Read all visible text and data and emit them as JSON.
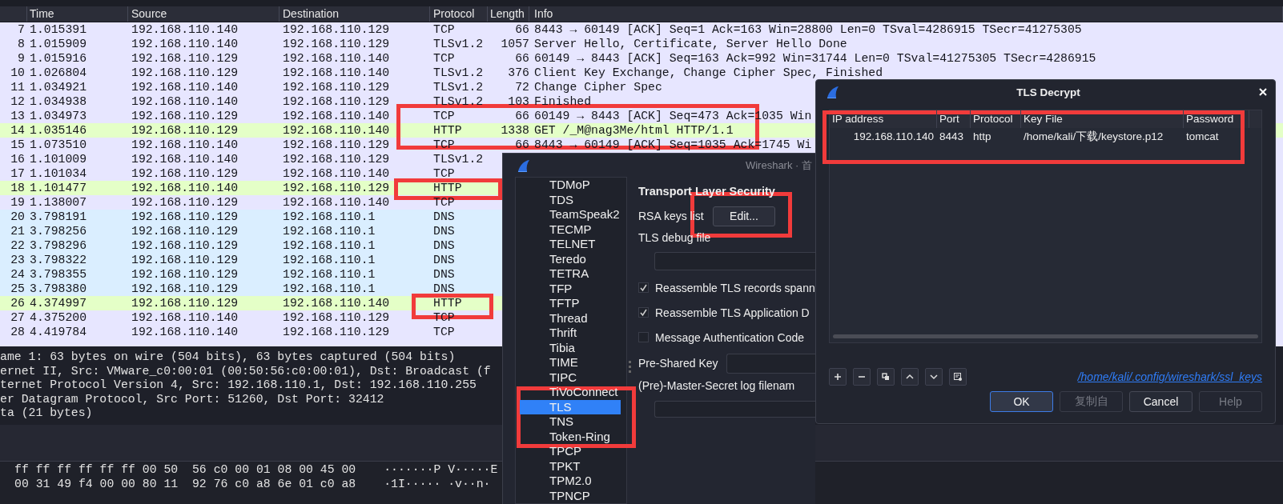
{
  "packet_list": {
    "columns": [
      "Time",
      "Source",
      "Destination",
      "Protocol",
      "Length",
      "Info"
    ],
    "rows": [
      {
        "no": "7",
        "time": "1.015391",
        "source": "192.168.110.140",
        "destination": "192.168.110.129",
        "protocol": "TCP",
        "length": "66",
        "info": "8443 → 60149 [ACK] Seq=1 Ack=163 Win=28800 Len=0 TSval=4286915 TSecr=41275305",
        "color": "#e7e6ff"
      },
      {
        "no": "8",
        "time": "1.015909",
        "source": "192.168.110.140",
        "destination": "192.168.110.129",
        "protocol": "TLSv1.2",
        "length": "1057",
        "info": "Server Hello, Certificate, Server Hello Done",
        "color": "#e7e6ff"
      },
      {
        "no": "9",
        "time": "1.015916",
        "source": "192.168.110.129",
        "destination": "192.168.110.140",
        "protocol": "TCP",
        "length": "66",
        "info": "60149 → 8443 [ACK] Seq=163 Ack=992 Win=31744 Len=0 TSval=41275305 TSecr=4286915",
        "color": "#e7e6ff"
      },
      {
        "no": "10",
        "time": "1.026804",
        "source": "192.168.110.129",
        "destination": "192.168.110.140",
        "protocol": "TLSv1.2",
        "length": "376",
        "info": "Client Key Exchange, Change Cipher Spec, Finished",
        "color": "#e7e6ff"
      },
      {
        "no": "11",
        "time": "1.034921",
        "source": "192.168.110.140",
        "destination": "192.168.110.129",
        "protocol": "TLSv1.2",
        "length": "72",
        "info": "Change Cipher Spec",
        "color": "#e7e6ff"
      },
      {
        "no": "12",
        "time": "1.034938",
        "source": "192.168.110.140",
        "destination": "192.168.110.129",
        "protocol": "TLSv1.2",
        "length": "103",
        "info": "Finished",
        "color": "#e7e6ff"
      },
      {
        "no": "13",
        "time": "1.034973",
        "source": "192.168.110.129",
        "destination": "192.168.110.140",
        "protocol": "TCP",
        "length": "66",
        "info": "60149 → 8443 [ACK] Seq=473 Ack=1035 Win",
        "color": "#e7e6ff"
      },
      {
        "no": "14",
        "time": "1.035146",
        "source": "192.168.110.129",
        "destination": "192.168.110.140",
        "protocol": "HTTP",
        "length": "1338",
        "info": "GET /_M@nag3Me/html HTTP/1.1",
        "color": "#e4ffc7"
      },
      {
        "no": "15",
        "time": "1.073510",
        "source": "192.168.110.140",
        "destination": "192.168.110.129",
        "protocol": "TCP",
        "length": "66",
        "info": "8443 → 60149 [ACK] Seq=1035 Ack=1745 Wi",
        "color": "#e7e6ff"
      },
      {
        "no": "16",
        "time": "1.101009",
        "source": "192.168.110.140",
        "destination": "192.168.110.129",
        "protocol": "TLSv1.2",
        "color": "#e7e6ff"
      },
      {
        "no": "17",
        "time": "1.101034",
        "source": "192.168.110.129",
        "destination": "192.168.110.140",
        "protocol": "TCP",
        "color": "#e7e6ff"
      },
      {
        "no": "18",
        "time": "1.101477",
        "source": "192.168.110.140",
        "destination": "192.168.110.129",
        "protocol": "HTTP",
        "color": "#e4ffc7"
      },
      {
        "no": "19",
        "time": "1.138007",
        "source": "192.168.110.129",
        "destination": "192.168.110.140",
        "protocol": "TCP",
        "color": "#e7e6ff"
      },
      {
        "no": "20",
        "time": "3.798191",
        "source": "192.168.110.129",
        "destination": "192.168.110.1",
        "protocol": "DNS",
        "color": "#daeeff"
      },
      {
        "no": "21",
        "time": "3.798256",
        "source": "192.168.110.129",
        "destination": "192.168.110.1",
        "protocol": "DNS",
        "color": "#daeeff"
      },
      {
        "no": "22",
        "time": "3.798296",
        "source": "192.168.110.129",
        "destination": "192.168.110.1",
        "protocol": "DNS",
        "color": "#daeeff"
      },
      {
        "no": "23",
        "time": "3.798322",
        "source": "192.168.110.129",
        "destination": "192.168.110.1",
        "protocol": "DNS",
        "color": "#daeeff"
      },
      {
        "no": "24",
        "time": "3.798355",
        "source": "192.168.110.129",
        "destination": "192.168.110.1",
        "protocol": "DNS",
        "color": "#daeeff"
      },
      {
        "no": "25",
        "time": "3.798380",
        "source": "192.168.110.129",
        "destination": "192.168.110.1",
        "protocol": "DNS",
        "color": "#daeeff"
      },
      {
        "no": "26",
        "time": "4.374997",
        "source": "192.168.110.129",
        "destination": "192.168.110.140",
        "protocol": "HTTP",
        "color": "#e4ffc7"
      },
      {
        "no": "27",
        "time": "4.375200",
        "source": "192.168.110.140",
        "destination": "192.168.110.129",
        "protocol": "TCP",
        "color": "#e7e6ff"
      },
      {
        "no": "28",
        "time": "4.419784",
        "source": "192.168.110.140",
        "destination": "192.168.110.129",
        "protocol": "TCP",
        "color": "#e7e6ff"
      }
    ]
  },
  "packet_details": [
    "ame 1: 63 bytes on wire (504 bits), 63 bytes captured (504 bits)",
    "ernet II, Src: VMware_c0:00:01 (00:50:56:c0:00:01), Dst: Broadcast (f",
    "ternet Protocol Version 4, Src: 192.168.110.1, Dst: 192.168.110.255",
    "er Datagram Protocol, Src Port: 51260, Dst Port: 32412",
    "ta (21 bytes)"
  ],
  "packet_bytes": [
    {
      "hex": "ff ff ff ff ff ff 00 50  56 c0 00 01 08 00 45 00",
      "ascii": "·······P V·····E"
    },
    {
      "hex": "00 31 49 f4 00 00 80 11  92 76 c0 a8 6e 01 c0 a8",
      "ascii": "·1I····· ·v··n·"
    }
  ],
  "preferences_dialog": {
    "title": "Wireshark · 首",
    "protocols": [
      {
        "label": "TDMoP",
        "selected": false
      },
      {
        "label": "TDS",
        "selected": false
      },
      {
        "label": "TeamSpeak2",
        "selected": false
      },
      {
        "label": "TECMP",
        "selected": false
      },
      {
        "label": "TELNET",
        "selected": false
      },
      {
        "label": "Teredo",
        "selected": false
      },
      {
        "label": "TETRA",
        "selected": false
      },
      {
        "label": "TFP",
        "selected": false
      },
      {
        "label": "TFTP",
        "selected": false
      },
      {
        "label": "Thread",
        "selected": false
      },
      {
        "label": "Thrift",
        "selected": false
      },
      {
        "label": "Tibia",
        "selected": false
      },
      {
        "label": "TIME",
        "selected": false
      },
      {
        "label": "TIPC",
        "selected": false
      },
      {
        "label": "TiVoConnect",
        "selected": false
      },
      {
        "label": "TLS",
        "selected": true
      },
      {
        "label": "TNS",
        "selected": false
      },
      {
        "label": "Token-Ring",
        "selected": false
      },
      {
        "label": "TPCP",
        "selected": false
      },
      {
        "label": "TPKT",
        "selected": false
      },
      {
        "label": "TPM2.0",
        "selected": false
      },
      {
        "label": "TPNCP",
        "selected": false
      }
    ],
    "section_title": "Transport Layer Security",
    "rsa_keys_label": "RSA keys list",
    "edit_button": "Edit...",
    "debug_file_label": "TLS debug file",
    "options": [
      {
        "label": "Reassemble TLS records spann",
        "checked": true
      },
      {
        "label": "Reassemble TLS Application D",
        "checked": true
      },
      {
        "label": "Message Authentication Code",
        "checked": false
      }
    ],
    "psk_label": "Pre-Shared Key",
    "master_secret_label": "(Pre)-Master-Secret log filenam"
  },
  "tls_decrypt_dialog": {
    "title": "TLS Decrypt",
    "columns": [
      "IP address",
      "Port",
      "Protocol",
      "Key File",
      "Password"
    ],
    "rows": [
      [
        "192.168.110.140",
        "8443",
        "http",
        "/home/kali/下载/keystore.p12",
        "tomcat"
      ]
    ],
    "file_link": "/home/kali/.config/wireshark/ssl_keys",
    "buttons": [
      {
        "label": "OK",
        "disabled": false,
        "focused": true
      },
      {
        "label": "复制自",
        "disabled": true,
        "focused": false
      },
      {
        "label": "Cancel",
        "disabled": false,
        "focused": false
      },
      {
        "label": "Help",
        "disabled": true,
        "focused": false
      }
    ]
  }
}
